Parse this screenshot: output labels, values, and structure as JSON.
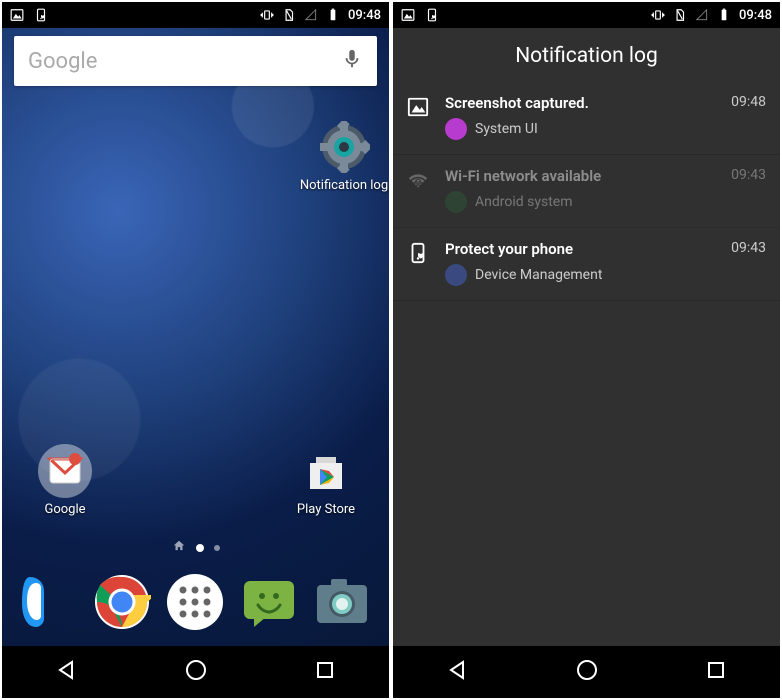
{
  "status": {
    "time": "09:48"
  },
  "home": {
    "search_placeholder": "Google",
    "notif_widget_label": "Notification log",
    "google_folder_label": "Google",
    "playstore_label": "Play Store"
  },
  "log": {
    "title": "Notification log",
    "items": [
      {
        "title": "Screenshot captured.",
        "source": "System UI",
        "time": "09:48",
        "dim": false,
        "icon": "image",
        "subcolor": "#b83bd0"
      },
      {
        "title": "Wi-Fi network available",
        "source": "Android system",
        "time": "09:43",
        "dim": true,
        "icon": "wifi",
        "subcolor": "#2f5b3a"
      },
      {
        "title": "Protect your phone",
        "source": "Device Management",
        "time": "09:43",
        "dim": false,
        "icon": "phone-shield",
        "subcolor": "#3a4a80"
      }
    ]
  }
}
